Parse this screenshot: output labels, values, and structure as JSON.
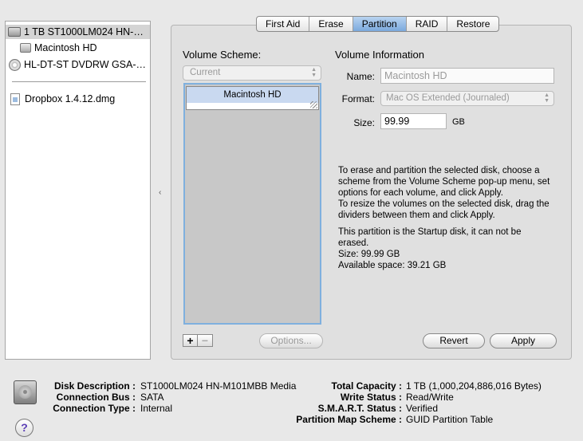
{
  "sidebar": {
    "items": [
      {
        "label": "1 TB ST1000LM024 HN-…",
        "icon": "hard-disk-icon",
        "selected": true
      },
      {
        "label": "Macintosh HD",
        "icon": "volume-icon"
      },
      {
        "label": "HL-DT-ST DVDRW GSA-…",
        "icon": "optical-disc-icon"
      },
      {
        "label": "Dropbox 1.4.12.dmg",
        "icon": "disk-image-icon"
      }
    ]
  },
  "tabs": [
    {
      "label": "First Aid"
    },
    {
      "label": "Erase"
    },
    {
      "label": "Partition",
      "active": true
    },
    {
      "label": "RAID"
    },
    {
      "label": "Restore"
    }
  ],
  "volume_scheme": {
    "heading": "Volume Scheme:",
    "popup_value": "Current",
    "partition_label": "Macintosh HD",
    "options_button": "Options...",
    "add_symbol": "+",
    "remove_symbol": "−"
  },
  "volume_info": {
    "heading": "Volume Information",
    "name_label": "Name:",
    "name_value": "Macintosh HD",
    "format_label": "Format:",
    "format_value": "Mac OS Extended (Journaled)",
    "size_label": "Size:",
    "size_value": "99.99",
    "size_unit": "GB",
    "instructions": [
      "To erase and partition the selected disk, choose a",
      "scheme from the Volume Scheme pop-up menu, set",
      "options for each volume, and click Apply.",
      "To resize the volumes on the selected disk, drag the",
      "dividers between them and click Apply."
    ],
    "status": [
      "This partition is the Startup disk, it can not be",
      "erased.",
      "Size: 99.99 GB",
      "Available space: 39.21 GB"
    ],
    "revert_button": "Revert",
    "apply_button": "Apply"
  },
  "disk_info": {
    "left": [
      {
        "key": "Disk Description :",
        "value": "ST1000LM024 HN-M101MBB Media"
      },
      {
        "key": "Connection Bus :",
        "value": "SATA"
      },
      {
        "key": "Connection Type :",
        "value": "Internal"
      }
    ],
    "right": [
      {
        "key": "Total Capacity :",
        "value": "1 TB (1,000,204,886,016 Bytes)"
      },
      {
        "key": "Write Status :",
        "value": "Read/Write"
      },
      {
        "key": "S.M.A.R.T. Status :",
        "value": "Verified"
      },
      {
        "key": "Partition Map Scheme :",
        "value": "GUID Partition Table"
      }
    ],
    "help_symbol": "?"
  },
  "colors": {
    "active_tab": "#7ba9dd",
    "selection_border": "#7fb0de",
    "partition_fill": "#c9d9f0"
  }
}
